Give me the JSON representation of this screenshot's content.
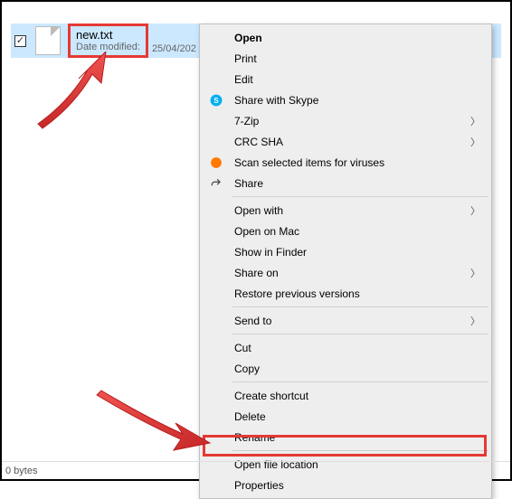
{
  "file": {
    "name": "new.txt",
    "date_label": "Date modified:",
    "date_value": "25/04/202"
  },
  "menu": {
    "open": "Open",
    "print": "Print",
    "edit": "Edit",
    "share_skype": "Share with Skype",
    "seven_zip": "7-Zip",
    "crc_sha": "CRC SHA",
    "scan_viruses": "Scan selected items for viruses",
    "share": "Share",
    "open_with": "Open with",
    "open_mac": "Open on Mac",
    "show_finder": "Show in Finder",
    "share_on": "Share on",
    "restore_prev": "Restore previous versions",
    "send_to": "Send to",
    "cut": "Cut",
    "copy": "Copy",
    "create_shortcut": "Create shortcut",
    "delete": "Delete",
    "rename": "Rename",
    "open_file_location": "Open file location",
    "properties": "Properties"
  },
  "status": {
    "size": "0 bytes"
  }
}
